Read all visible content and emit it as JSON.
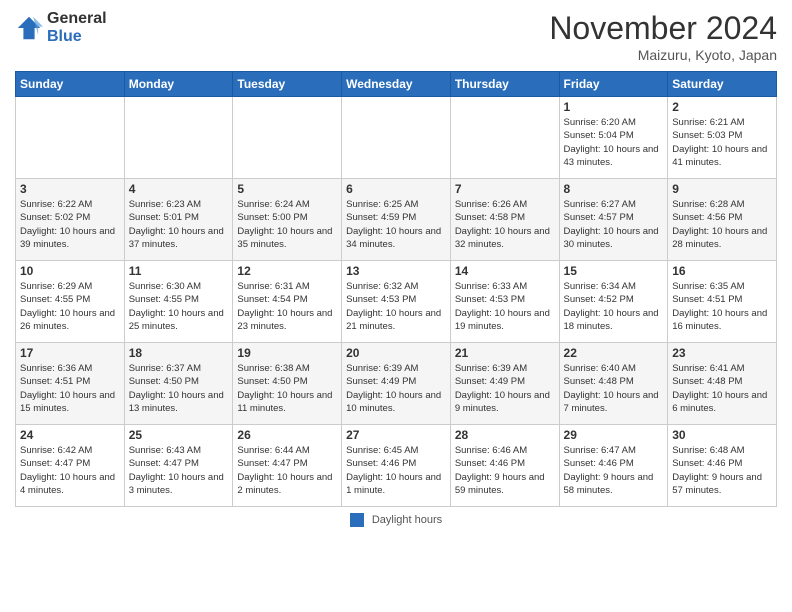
{
  "header": {
    "logo_general": "General",
    "logo_blue": "Blue",
    "month": "November 2024",
    "location": "Maizuru, Kyoto, Japan"
  },
  "weekdays": [
    "Sunday",
    "Monday",
    "Tuesday",
    "Wednesday",
    "Thursday",
    "Friday",
    "Saturday"
  ],
  "footer": {
    "legend_label": "Daylight hours"
  },
  "weeks": [
    [
      {
        "day": "",
        "info": ""
      },
      {
        "day": "",
        "info": ""
      },
      {
        "day": "",
        "info": ""
      },
      {
        "day": "",
        "info": ""
      },
      {
        "day": "",
        "info": ""
      },
      {
        "day": "1",
        "info": "Sunrise: 6:20 AM\nSunset: 5:04 PM\nDaylight: 10 hours and 43 minutes."
      },
      {
        "day": "2",
        "info": "Sunrise: 6:21 AM\nSunset: 5:03 PM\nDaylight: 10 hours and 41 minutes."
      }
    ],
    [
      {
        "day": "3",
        "info": "Sunrise: 6:22 AM\nSunset: 5:02 PM\nDaylight: 10 hours and 39 minutes."
      },
      {
        "day": "4",
        "info": "Sunrise: 6:23 AM\nSunset: 5:01 PM\nDaylight: 10 hours and 37 minutes."
      },
      {
        "day": "5",
        "info": "Sunrise: 6:24 AM\nSunset: 5:00 PM\nDaylight: 10 hours and 35 minutes."
      },
      {
        "day": "6",
        "info": "Sunrise: 6:25 AM\nSunset: 4:59 PM\nDaylight: 10 hours and 34 minutes."
      },
      {
        "day": "7",
        "info": "Sunrise: 6:26 AM\nSunset: 4:58 PM\nDaylight: 10 hours and 32 minutes."
      },
      {
        "day": "8",
        "info": "Sunrise: 6:27 AM\nSunset: 4:57 PM\nDaylight: 10 hours and 30 minutes."
      },
      {
        "day": "9",
        "info": "Sunrise: 6:28 AM\nSunset: 4:56 PM\nDaylight: 10 hours and 28 minutes."
      }
    ],
    [
      {
        "day": "10",
        "info": "Sunrise: 6:29 AM\nSunset: 4:55 PM\nDaylight: 10 hours and 26 minutes."
      },
      {
        "day": "11",
        "info": "Sunrise: 6:30 AM\nSunset: 4:55 PM\nDaylight: 10 hours and 25 minutes."
      },
      {
        "day": "12",
        "info": "Sunrise: 6:31 AM\nSunset: 4:54 PM\nDaylight: 10 hours and 23 minutes."
      },
      {
        "day": "13",
        "info": "Sunrise: 6:32 AM\nSunset: 4:53 PM\nDaylight: 10 hours and 21 minutes."
      },
      {
        "day": "14",
        "info": "Sunrise: 6:33 AM\nSunset: 4:53 PM\nDaylight: 10 hours and 19 minutes."
      },
      {
        "day": "15",
        "info": "Sunrise: 6:34 AM\nSunset: 4:52 PM\nDaylight: 10 hours and 18 minutes."
      },
      {
        "day": "16",
        "info": "Sunrise: 6:35 AM\nSunset: 4:51 PM\nDaylight: 10 hours and 16 minutes."
      }
    ],
    [
      {
        "day": "17",
        "info": "Sunrise: 6:36 AM\nSunset: 4:51 PM\nDaylight: 10 hours and 15 minutes."
      },
      {
        "day": "18",
        "info": "Sunrise: 6:37 AM\nSunset: 4:50 PM\nDaylight: 10 hours and 13 minutes."
      },
      {
        "day": "19",
        "info": "Sunrise: 6:38 AM\nSunset: 4:50 PM\nDaylight: 10 hours and 11 minutes."
      },
      {
        "day": "20",
        "info": "Sunrise: 6:39 AM\nSunset: 4:49 PM\nDaylight: 10 hours and 10 minutes."
      },
      {
        "day": "21",
        "info": "Sunrise: 6:39 AM\nSunset: 4:49 PM\nDaylight: 10 hours and 9 minutes."
      },
      {
        "day": "22",
        "info": "Sunrise: 6:40 AM\nSunset: 4:48 PM\nDaylight: 10 hours and 7 minutes."
      },
      {
        "day": "23",
        "info": "Sunrise: 6:41 AM\nSunset: 4:48 PM\nDaylight: 10 hours and 6 minutes."
      }
    ],
    [
      {
        "day": "24",
        "info": "Sunrise: 6:42 AM\nSunset: 4:47 PM\nDaylight: 10 hours and 4 minutes."
      },
      {
        "day": "25",
        "info": "Sunrise: 6:43 AM\nSunset: 4:47 PM\nDaylight: 10 hours and 3 minutes."
      },
      {
        "day": "26",
        "info": "Sunrise: 6:44 AM\nSunset: 4:47 PM\nDaylight: 10 hours and 2 minutes."
      },
      {
        "day": "27",
        "info": "Sunrise: 6:45 AM\nSunset: 4:46 PM\nDaylight: 10 hours and 1 minute."
      },
      {
        "day": "28",
        "info": "Sunrise: 6:46 AM\nSunset: 4:46 PM\nDaylight: 9 hours and 59 minutes."
      },
      {
        "day": "29",
        "info": "Sunrise: 6:47 AM\nSunset: 4:46 PM\nDaylight: 9 hours and 58 minutes."
      },
      {
        "day": "30",
        "info": "Sunrise: 6:48 AM\nSunset: 4:46 PM\nDaylight: 9 hours and 57 minutes."
      }
    ]
  ]
}
